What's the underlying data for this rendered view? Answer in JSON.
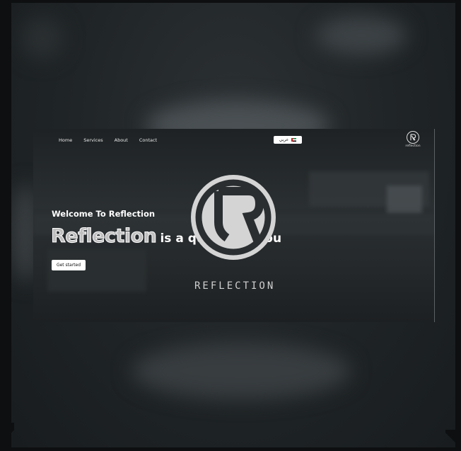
{
  "nav": {
    "items": [
      {
        "label": "Home"
      },
      {
        "label": "Services"
      },
      {
        "label": "About"
      },
      {
        "label": "Contact"
      }
    ]
  },
  "language_button": {
    "label": "عربي",
    "flag_icon": "uae-flag-icon"
  },
  "brand": {
    "logo_text": "reflection"
  },
  "hero": {
    "welcome": "Welcome To Reflection",
    "highlight": "Reflection",
    "tagline": "is a quality of you",
    "cta_label": "Get started"
  },
  "emblem": {
    "wordmark": "REFLECTION"
  },
  "colors": {
    "background": "#1f2426",
    "text": "#ffffff",
    "button": "#ffffff"
  }
}
